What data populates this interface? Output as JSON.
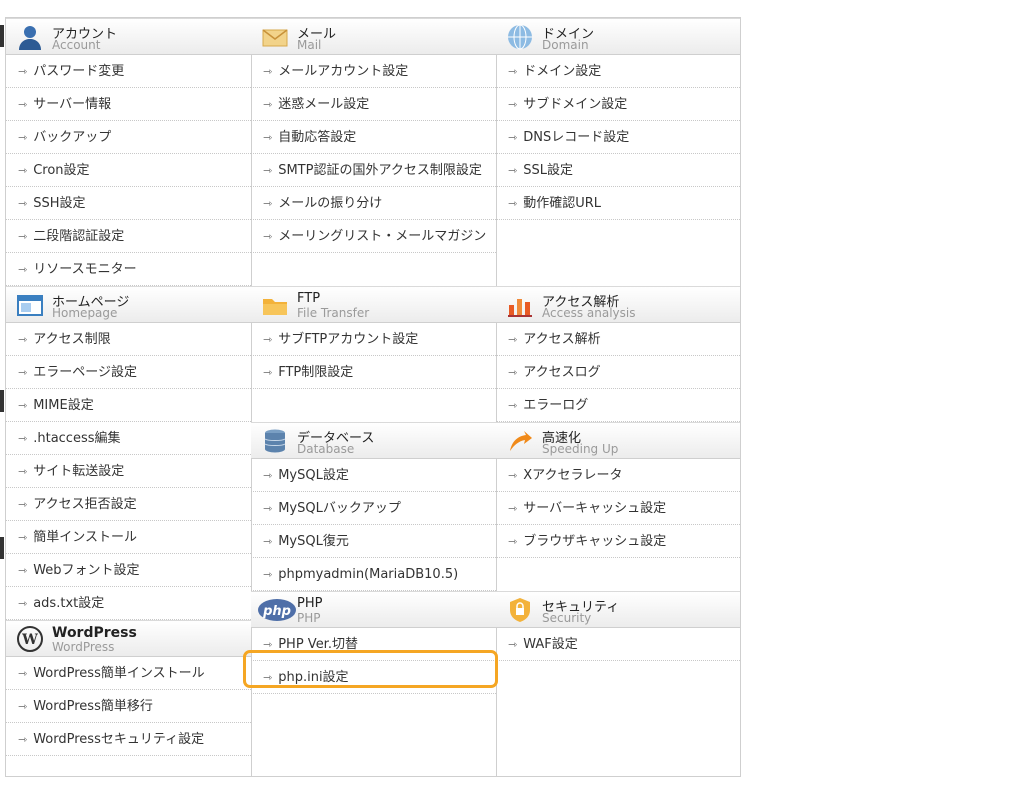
{
  "col1": [
    {
      "key": "account",
      "jp": "アカウント",
      "en": "Account",
      "icon": "user-icon",
      "items": [
        "パスワード変更",
        "サーバー情報",
        "バックアップ",
        "Cron設定",
        "SSH設定",
        "二段階認証設定",
        "リソースモニター"
      ]
    },
    {
      "key": "homepage",
      "jp": "ホームページ",
      "en": "Homepage",
      "icon": "browser-window-icon",
      "items": [
        "アクセス制限",
        "エラーページ設定",
        "MIME設定",
        ".htaccess編集",
        "サイト転送設定",
        "アクセス拒否設定",
        "簡単インストール",
        "Webフォント設定",
        "ads.txt設定"
      ]
    },
    {
      "key": "wordpress",
      "jp": "WordPress",
      "en": "WordPress",
      "icon": "wordpress-icon",
      "items": [
        "WordPress簡単インストール",
        "WordPress簡単移行",
        "WordPressセキュリティ設定"
      ]
    }
  ],
  "col2": [
    {
      "key": "mail",
      "jp": "メール",
      "en": "Mail",
      "icon": "envelope-icon",
      "items": [
        "メールアカウント設定",
        "迷惑メール設定",
        "自動応答設定",
        "SMTP認証の国外アクセス制限設定",
        "メールの振り分け",
        "メーリングリスト・メールマガジン"
      ],
      "empty": 1
    },
    {
      "key": "ftp",
      "jp": "FTP",
      "en": "File Transfer",
      "icon": "folder-icon",
      "items": [
        "サブFTPアカウント設定",
        "FTP制限設定"
      ],
      "empty": 1
    },
    {
      "key": "database",
      "jp": "データベース",
      "en": "Database",
      "icon": "database-icon",
      "items": [
        "MySQL設定",
        "MySQLバックアップ",
        "MySQL復元",
        "phpmyadmin(MariaDB10.5)"
      ]
    },
    {
      "key": "php",
      "jp": "PHP",
      "en": "PHP",
      "icon": "php-icon",
      "items": [
        "PHP Ver.切替",
        "php.ini設定"
      ]
    }
  ],
  "col3": [
    {
      "key": "domain",
      "jp": "ドメイン",
      "en": "Domain",
      "icon": "globe-icon",
      "items": [
        "ドメイン設定",
        "サブドメイン設定",
        "DNSレコード設定",
        "SSL設定",
        "動作確認URL"
      ],
      "empty": 2
    },
    {
      "key": "access",
      "jp": "アクセス解析",
      "en": "Access analysis",
      "icon": "bar-chart-icon",
      "items": [
        "アクセス解析",
        "アクセスログ",
        "エラーログ"
      ]
    },
    {
      "key": "speed",
      "jp": "高速化",
      "en": "Speeding Up",
      "icon": "speed-arrow-icon",
      "items": [
        "Xアクセラレータ",
        "サーバーキャッシュ設定",
        "ブラウザキャッシュ設定"
      ],
      "empty": 1
    },
    {
      "key": "security",
      "jp": "セキュリティ",
      "en": "Security",
      "icon": "lock-shield-icon",
      "items": [
        "WAF設定"
      ]
    }
  ],
  "arrow_glyph": "⇾"
}
